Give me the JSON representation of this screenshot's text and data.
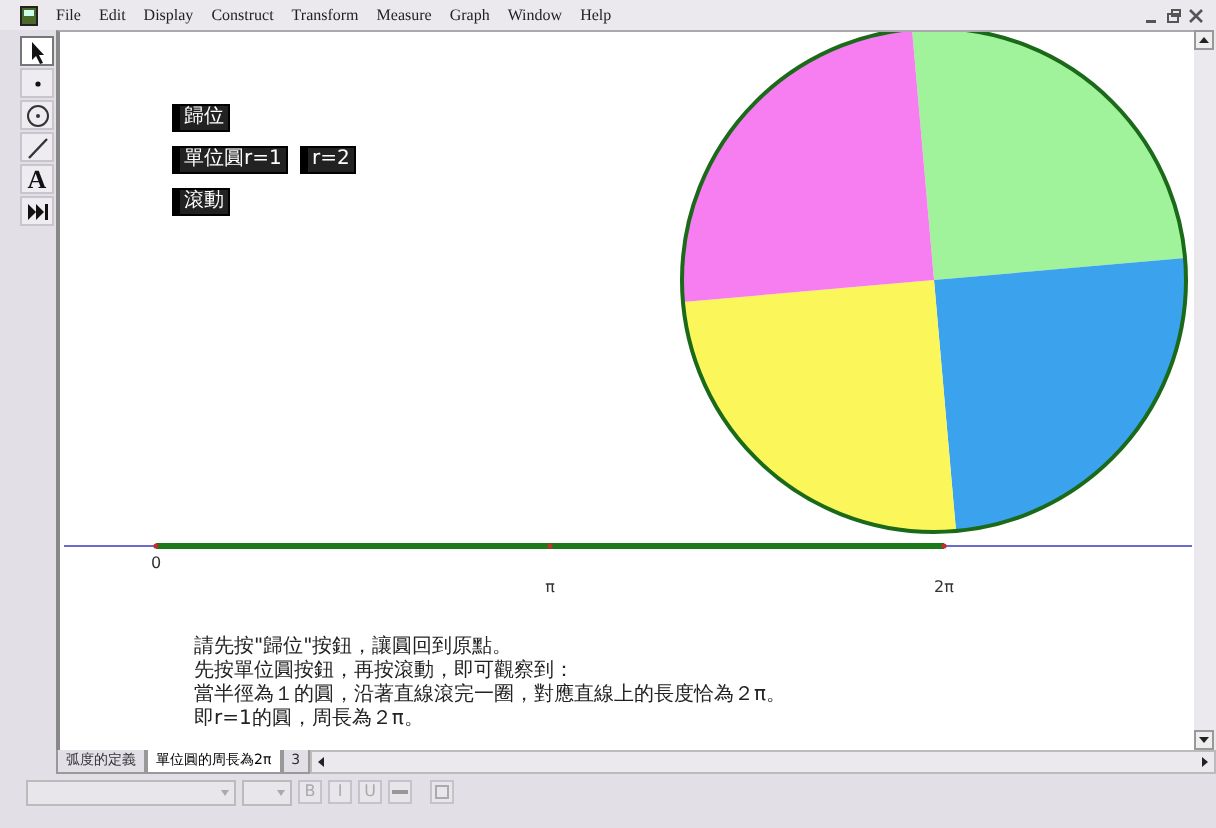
{
  "menu": [
    "File",
    "Edit",
    "Display",
    "Construct",
    "Transform",
    "Measure",
    "Graph",
    "Window",
    "Help"
  ],
  "tools": [
    {
      "kind": "arrow",
      "selected": true
    },
    {
      "kind": "point",
      "selected": false
    },
    {
      "kind": "compass",
      "selected": false
    },
    {
      "kind": "line",
      "selected": false
    },
    {
      "kind": "text",
      "glyph": "A",
      "selected": false
    },
    {
      "kind": "custom",
      "selected": false
    }
  ],
  "canvas_buttons": [
    [
      "歸位"
    ],
    [
      "單位圓r=1",
      "r=2"
    ],
    [
      "滾動"
    ]
  ],
  "axis_labels": [
    "0",
    "π",
    "2π"
  ],
  "notes": [
    "請先按\"歸位\"按鈕，讓圓回到原點。",
    "先按單位圓按鈕，再按滾動，即可觀察到：",
    "當半徑為１的圓，沿著直線滾完一圈，對應直線上的長度恰為２π。",
    "即r=1的圓，周長為２π。"
  ],
  "tabs": [
    {
      "label": "弧度的定義",
      "selected": false
    },
    {
      "label": "單位圓的周長為2π",
      "selected": true
    },
    {
      "label": "3",
      "selected": false
    }
  ],
  "format_bar": {
    "style_buttons": [
      "B",
      "I",
      "U"
    ]
  }
}
